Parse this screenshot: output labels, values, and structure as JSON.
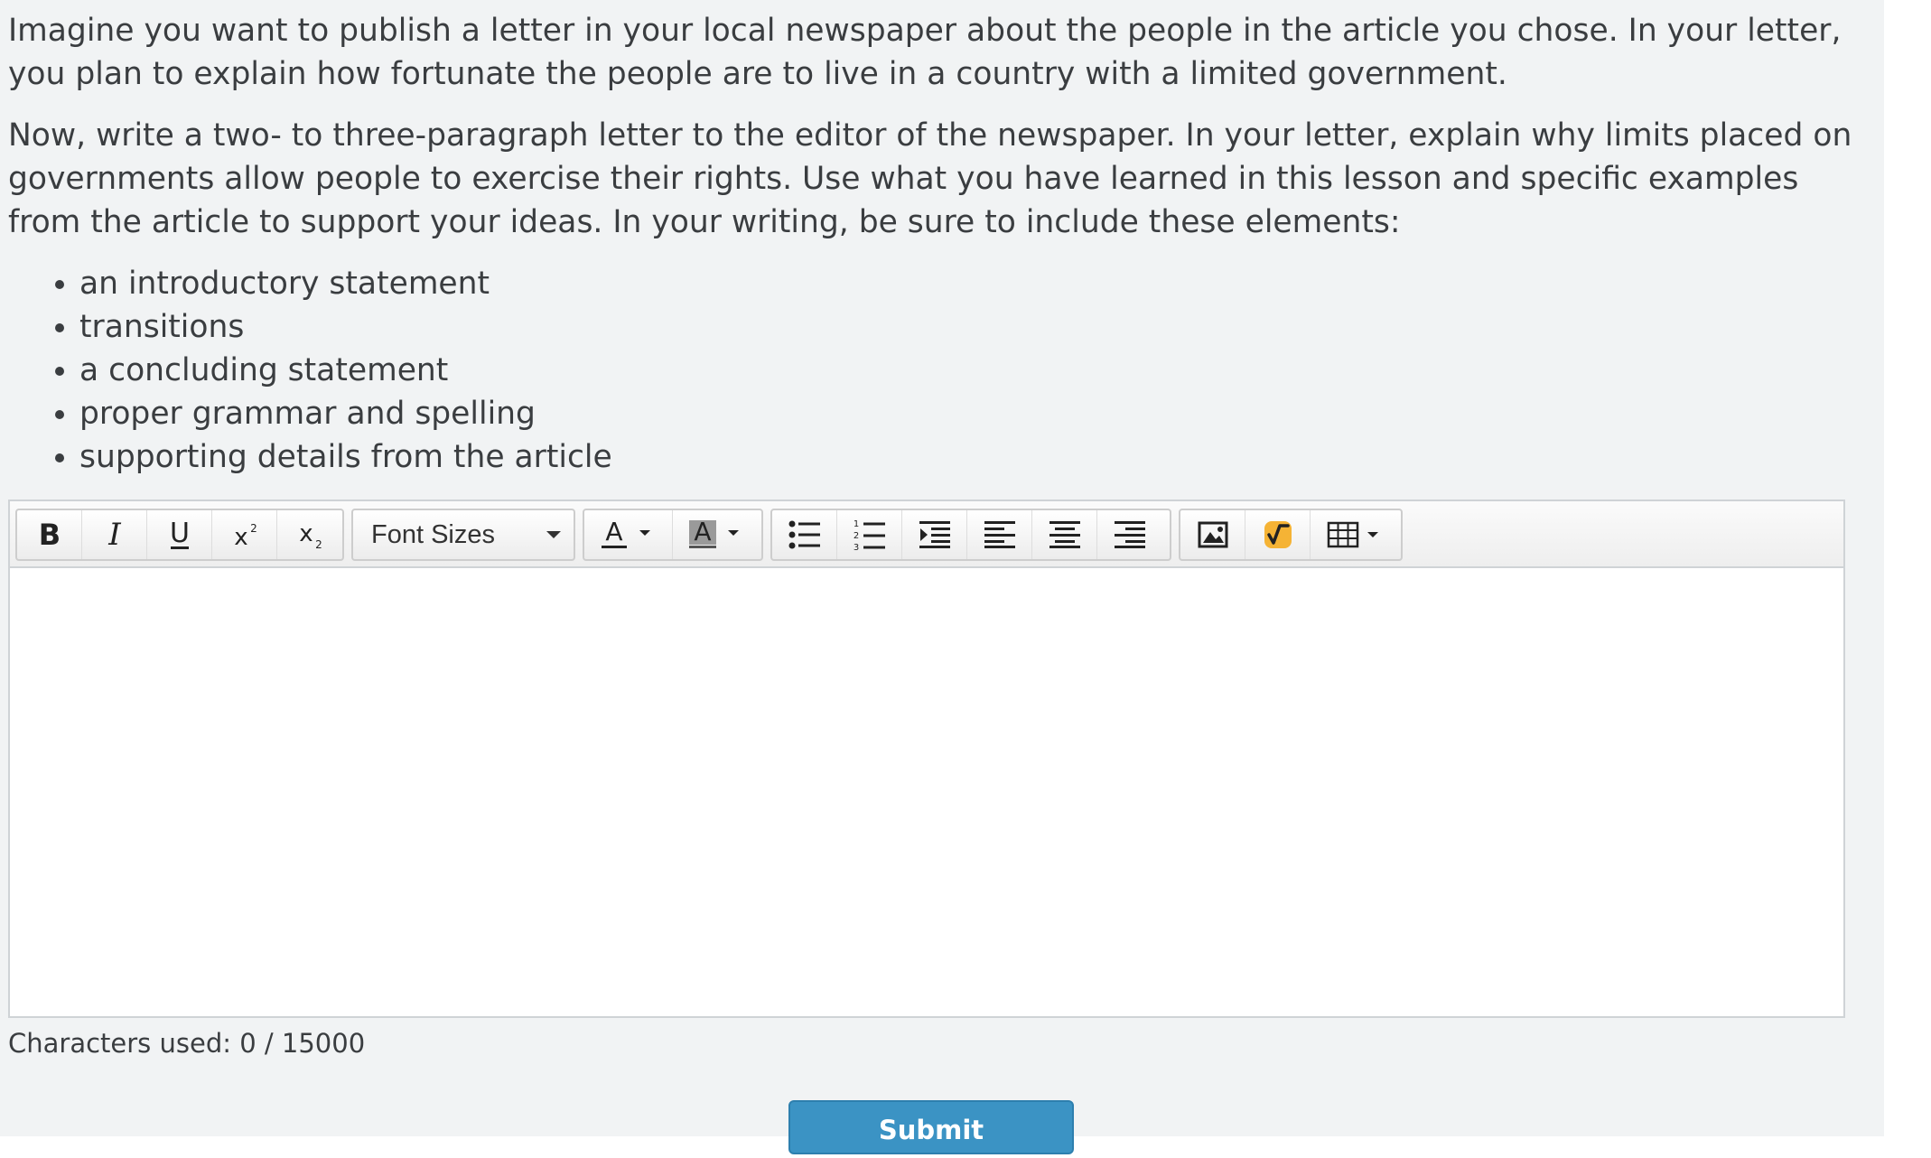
{
  "prompt": {
    "paragraph1": "Imagine you want to publish a letter in your local newspaper about the people in the article you chose. In your letter, you plan to explain how fortunate the people are to live in a country with a limited government.",
    "paragraph2": "Now, write a two- to three-paragraph letter to the editor of the newspaper. In your letter, explain why limits placed on governments allow people to exercise their rights. Use what you have learned in this lesson and specific examples from the article to support your ideas. In your writing, be sure to include these elements:",
    "elements": [
      "an introductory statement",
      "transitions",
      "a concluding statement",
      "proper grammar and spelling",
      "supporting details from the article"
    ]
  },
  "toolbar": {
    "font_sizes_label": "Font Sizes",
    "icons": [
      "bold-icon",
      "italic-icon",
      "underline-icon",
      "superscript-icon",
      "subscript-icon",
      "font-color-icon",
      "highlight-color-icon",
      "bullet-list-icon",
      "numbered-list-icon",
      "indent-icon",
      "align-left-icon",
      "align-center-icon",
      "align-right-icon",
      "image-icon",
      "math-equation-icon",
      "table-icon"
    ],
    "math_icon_color": "#f5b335"
  },
  "editor": {
    "content": ""
  },
  "counter": {
    "label": "Characters used: 0 / 15000"
  },
  "submit": {
    "label": "Submit",
    "color": "#3b93c4"
  }
}
